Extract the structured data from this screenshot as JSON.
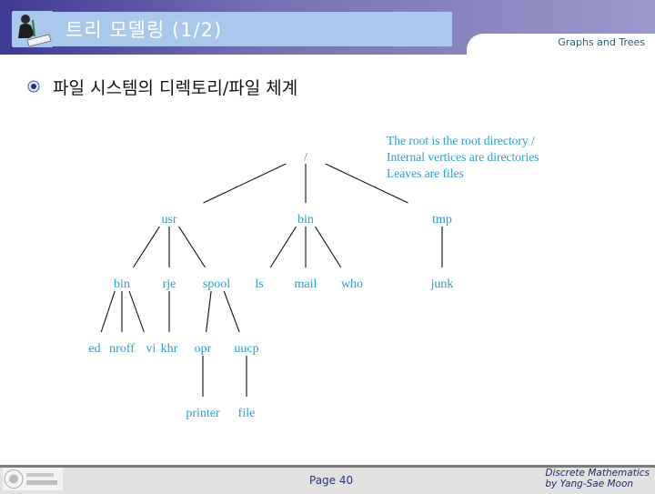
{
  "header": {
    "title": "트리 모델링 (1/2)",
    "subject": "Graphs and Trees",
    "logo_icon": "presenter-figure-icon"
  },
  "content": {
    "bullet_icon": "emblem-bullet-icon",
    "bullet_text": "파일 시스템의 디렉토리/파일 체계"
  },
  "tree": {
    "notes": [
      "The root is the root directory /",
      "Internal vertices are directories",
      "Leaves are files"
    ],
    "nodes": [
      {
        "id": "root",
        "label": "/"
      },
      {
        "id": "usr",
        "label": "usr"
      },
      {
        "id": "bin1",
        "label": "bin"
      },
      {
        "id": "tmp",
        "label": "tmp"
      },
      {
        "id": "bin2",
        "label": "bin"
      },
      {
        "id": "rje",
        "label": "rje"
      },
      {
        "id": "spool",
        "label": "spool"
      },
      {
        "id": "ls",
        "label": "ls"
      },
      {
        "id": "mail",
        "label": "mail"
      },
      {
        "id": "who",
        "label": "who"
      },
      {
        "id": "junk",
        "label": "junk"
      },
      {
        "id": "ed",
        "label": "ed"
      },
      {
        "id": "nroff",
        "label": "nroff"
      },
      {
        "id": "vi",
        "label": "vi"
      },
      {
        "id": "khr",
        "label": "khr"
      },
      {
        "id": "opr",
        "label": "opr"
      },
      {
        "id": "uucp",
        "label": "uucp"
      },
      {
        "id": "printer",
        "label": "printer"
      },
      {
        "id": "file",
        "label": "file"
      }
    ],
    "edges": [
      [
        "root",
        "usr"
      ],
      [
        "root",
        "bin1"
      ],
      [
        "root",
        "tmp"
      ],
      [
        "usr",
        "bin2"
      ],
      [
        "usr",
        "rje"
      ],
      [
        "usr",
        "spool"
      ],
      [
        "bin1",
        "ls"
      ],
      [
        "bin1",
        "mail"
      ],
      [
        "bin1",
        "who"
      ],
      [
        "tmp",
        "junk"
      ],
      [
        "bin2",
        "ed"
      ],
      [
        "bin2",
        "nroff"
      ],
      [
        "bin2",
        "vi"
      ],
      [
        "rje",
        "khr"
      ],
      [
        "spool",
        "opr"
      ],
      [
        "spool",
        "uucp"
      ],
      [
        "opr",
        "printer"
      ],
      [
        "uucp",
        "file"
      ]
    ]
  },
  "footer": {
    "page_label": "Page 40",
    "credit_line1": "Discrete Mathematics",
    "credit_line2": "by Yang-Sae Moon",
    "logo_icon": "university-logo-icon"
  }
}
